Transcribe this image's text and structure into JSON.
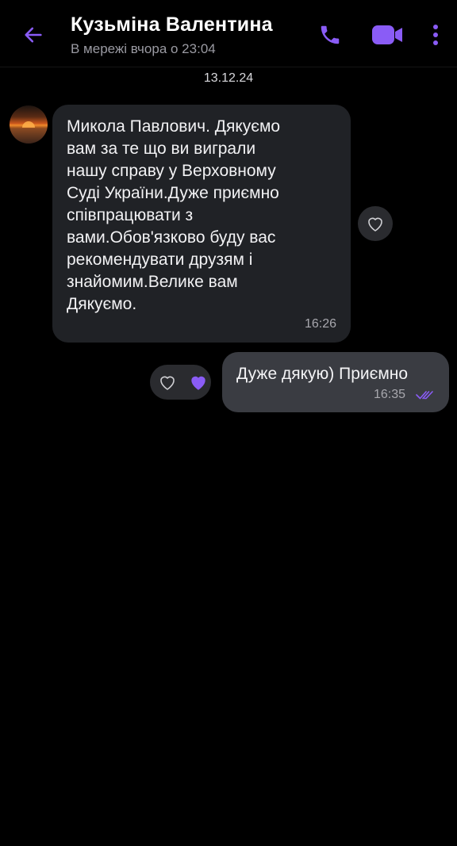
{
  "header": {
    "contact_name": "Кузьміна Валентина",
    "status": "В мережі вчора о 23:04"
  },
  "colors": {
    "accent": "#8a5cf6",
    "background": "#000000",
    "incoming_bubble": "#202226",
    "outgoing_bubble": "#3a3c42"
  },
  "icons": {
    "back": "arrow-left-icon",
    "call": "phone-icon",
    "video": "video-camera-icon",
    "menu": "more-vertical-icon",
    "like": "heart-outline-icon",
    "liked": "heart-filled-icon",
    "read": "double-check-icon"
  },
  "chat": {
    "date": "13.12.24",
    "messages": [
      {
        "direction": "incoming",
        "text": "Микола Павлович. Дякуємо\nвам за те що   ви виграли\nнашу справу у Верховному\nСуді України.Дуже приємно\nспівпрацювати з\nвами.Обов'язково буду вас\nрекомендувати друзям і\nзнайомим.Велике вам\nДякуємо.",
        "time": "16:26"
      },
      {
        "direction": "outgoing",
        "text": "Дуже дякую) Приємно",
        "time": "16:35",
        "status": "read"
      }
    ]
  }
}
